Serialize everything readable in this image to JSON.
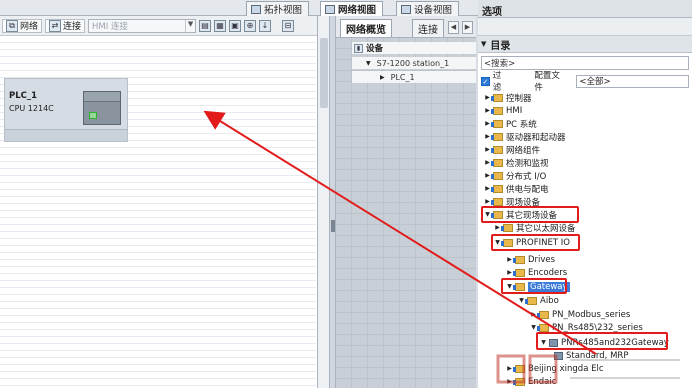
{
  "view_tabs": {
    "topology": "拓扑视图",
    "network": "网络视图",
    "device": "设备视图"
  },
  "toolbar": {
    "network_label": "网络",
    "connection_label": "连接",
    "connection_type_placeholder": "HMI 连接"
  },
  "plc": {
    "name": "PLC_1",
    "cpu": "CPU 1214C"
  },
  "overview": {
    "tab_active": "网络概览",
    "tab_other": "连接",
    "header": "设备",
    "rows": [
      "S7-1200 station_1",
      "PLC_1"
    ]
  },
  "options": {
    "title": "选项",
    "catalog_header": "目录",
    "search_placeholder": "<搜索>",
    "filter_label": "过滤",
    "profile_label": "配置文件",
    "profile_value": "<全部>",
    "tree": [
      "控制器",
      "HMI",
      "PC 系统",
      "驱动器和起动器",
      "网络组件",
      "检测和监视",
      "分布式 I/O",
      "供电与配电",
      "现场设备",
      "其它现场设备",
      "其它以太网设备",
      "PROFINET IO",
      "Drives",
      "Encoders",
      "Gateway",
      "Aibo",
      "PN_Modbus_series",
      "PN_Rs485\\232_series",
      "PNRs485and232Gateway",
      "Standard, MRP",
      "Beijing xingda Elc",
      "Endaic"
    ]
  },
  "colors": {
    "highlight": "#e21b1b",
    "folder": "#e8b84a",
    "accent_blue": "#2f7ad6"
  }
}
